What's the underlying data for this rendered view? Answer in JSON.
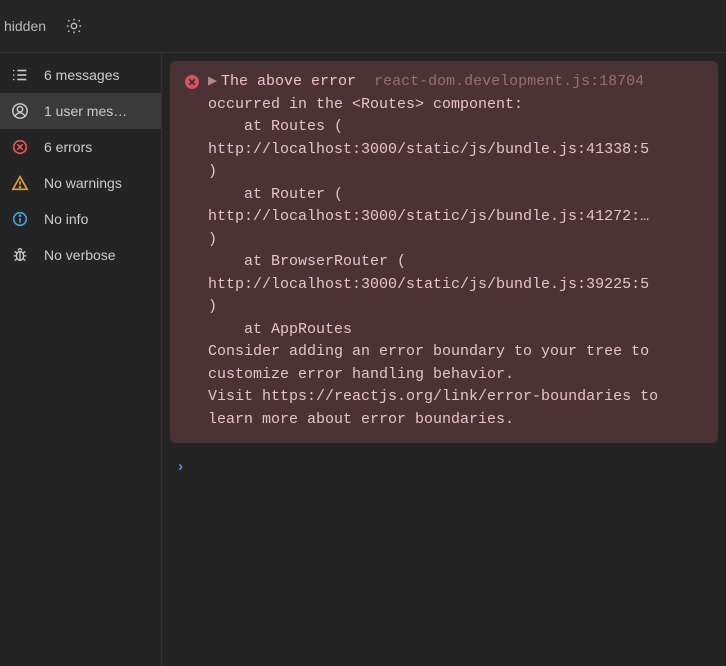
{
  "topbar": {
    "hidden_label": "hidden"
  },
  "sidebar": {
    "items": [
      {
        "label": "6 messages"
      },
      {
        "label": "1 user mes…"
      },
      {
        "label": "6 errors"
      },
      {
        "label": "No warnings"
      },
      {
        "label": "No info"
      },
      {
        "label": "No verbose"
      }
    ]
  },
  "error": {
    "caret": "▶",
    "title": "The above error",
    "source": "react-dom.development.js:18704",
    "line_occurred": "occurred in the <Routes> component:",
    "blank": "",
    "indent_at_routes": "    at Routes (",
    "link1": "http://localhost:3000/static/js/bundle.js:41338:5",
    "close_paren": ")",
    "indent_at_router": "    at Router (",
    "link2": "http://localhost:3000/static/js/bundle.js:41272:…",
    "indent_at_browserrouter": "    at BrowserRouter (",
    "link3": "http://localhost:3000/static/js/bundle.js:39225:5",
    "indent_at_approutes": "    at AppRoutes",
    "consider": "Consider adding an error boundary to your tree to customize error handling behavior.",
    "visit_prefix": "Visit ",
    "visit_link": "https://reactjs.org/link/error-boundaries",
    "visit_suffix": " to learn more about error boundaries."
  },
  "prompt": {
    "chev": "›"
  }
}
